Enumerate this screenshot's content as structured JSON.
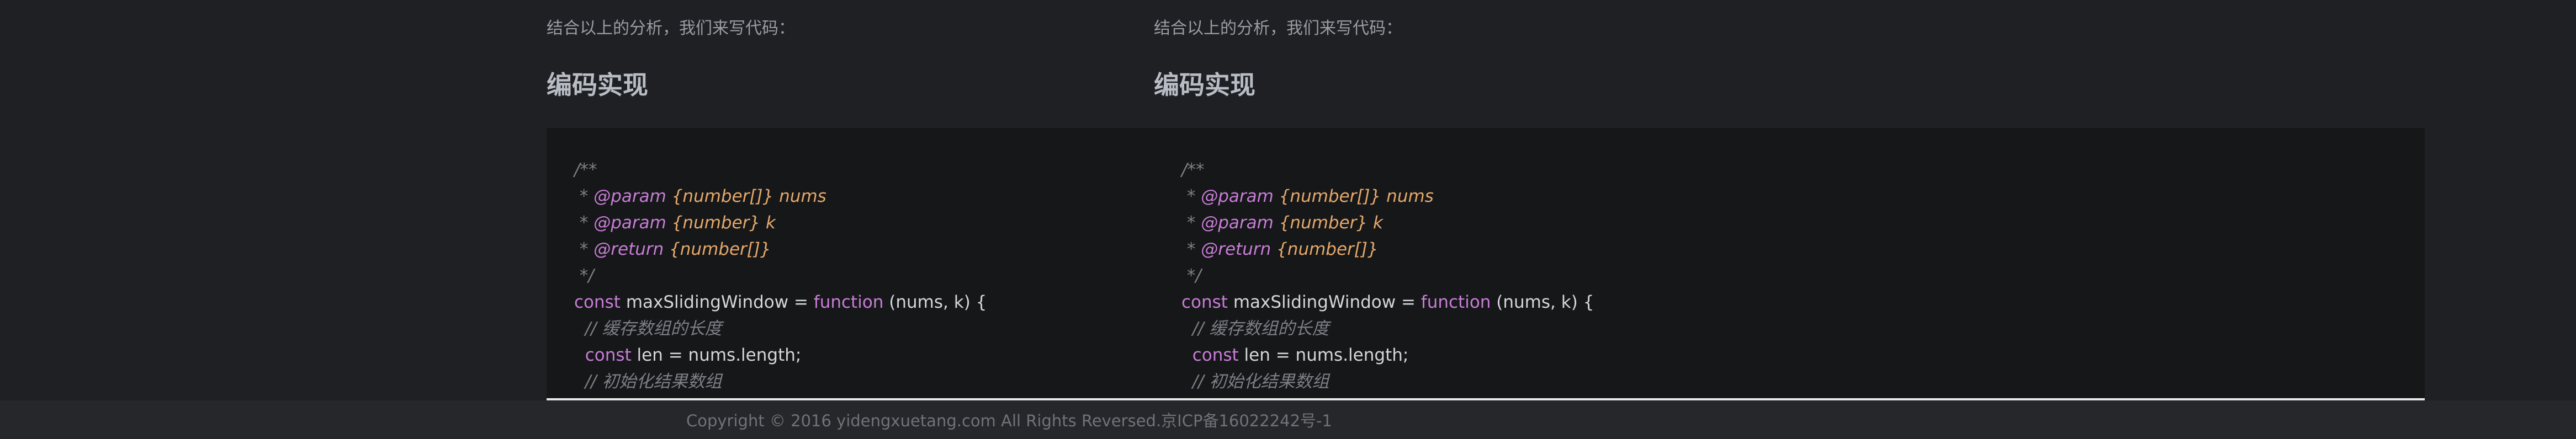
{
  "article": {
    "intro": "结合以上的分析，我们来写代码：",
    "heading": "编码实现",
    "code": {
      "doc_open": "/**",
      "param1_prefix": " * ",
      "param1_tag": "@param",
      "param1_type": " {number[]} nums",
      "param2_prefix": " * ",
      "param2_tag": "@param",
      "param2_type": " {number} k",
      "return_prefix": " * ",
      "return_tag": "@return",
      "return_type": " {number[]}",
      "doc_close": " */",
      "decl_kw": "const",
      "decl_name": " maxSlidingWindow = ",
      "decl_fn": "function",
      "decl_args": " (nums, k) {",
      "comment1": "  // 缓存数组的长度",
      "len_indent": "  ",
      "len_kw": "const",
      "len_expr": " len = nums.length;",
      "comment2": "  // 初始化结果数组"
    }
  },
  "footer": {
    "copyright": "Copyright © 2016 yidengxuetang.com All Rights Reversed.京ICP备16022242号-1"
  },
  "colors": {
    "background": "#1f2023",
    "code_background": "#161719",
    "keyword": "#c77dd6",
    "type": "#e5a86a",
    "comment": "#7c7f86"
  }
}
